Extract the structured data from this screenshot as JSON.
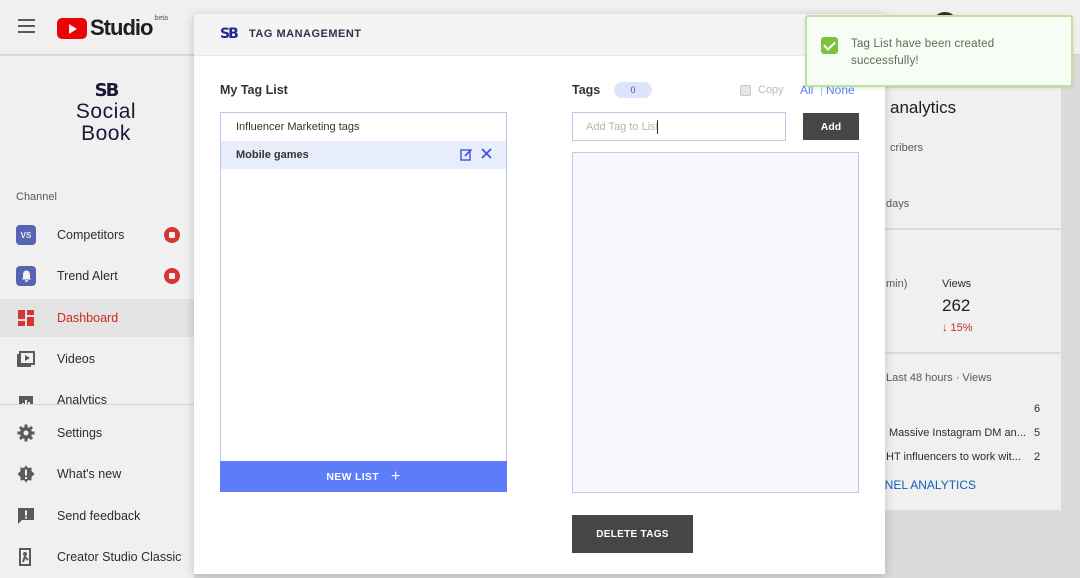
{
  "studio": {
    "logo_word": "Studio",
    "beta": "beta"
  },
  "brand": {
    "mark": "SB",
    "line1": "Social",
    "line2": "Book"
  },
  "sidebar": {
    "section_label": "Channel",
    "items": [
      {
        "label": "Competitors",
        "icon": "vs-icon",
        "badge": true
      },
      {
        "label": "Trend Alert",
        "icon": "bell-icon",
        "badge": true
      },
      {
        "label": "Dashboard",
        "icon": "dashboard-icon",
        "active": true
      },
      {
        "label": "Videos",
        "icon": "video-icon"
      },
      {
        "label": "Analytics",
        "icon": "analytics-icon"
      },
      {
        "label": "Settings",
        "icon": "gear-icon"
      },
      {
        "label": "What's new",
        "icon": "whats-new-icon"
      },
      {
        "label": "Send feedback",
        "icon": "feedback-icon"
      },
      {
        "label": "Creator Studio Classic",
        "icon": "exit-icon"
      }
    ]
  },
  "background_dashboard": {
    "analytics_title": "analytics",
    "subscribers_fragment": "cribers",
    "days_fragment": "days",
    "min_fragment": "min)",
    "views_label": "Views",
    "views_value": "262",
    "views_change": "↓ 15%",
    "last48": "Last 48 hours · Views",
    "rows": [
      {
        "title": "",
        "value": "6"
      },
      {
        "title": "Massive Instagram DM an...",
        "value": "5"
      },
      {
        "title": "HT influencers to work wit...",
        "value": "2"
      }
    ],
    "channel_analytics_link": "NNEL ANALYTICS"
  },
  "modal": {
    "logo": "SB",
    "title": "TAG MANAGEMENT",
    "my_tag_list": {
      "heading": "My Tag List",
      "items": [
        {
          "label": "Influencer Marketing tags",
          "selected": false
        },
        {
          "label": "Mobile games",
          "selected": true
        }
      ],
      "new_list_label": "NEW LIST",
      "new_list_plus": "+"
    },
    "tags": {
      "heading": "Tags",
      "count": "0",
      "copy_label": "Copy",
      "select_all": "All",
      "separator": "|",
      "select_none": "None",
      "input_value": "",
      "input_placeholder": "Add Tag to List",
      "add_label": "Add",
      "delete_label": "DELETE TAGS"
    }
  },
  "toast": {
    "message": "Tag List have been created successfully!",
    "color": "#7cc242"
  },
  "colors": {
    "accent": "#5c7cfa",
    "youtube_red": "#ff0000",
    "dark_button": "#464646"
  }
}
